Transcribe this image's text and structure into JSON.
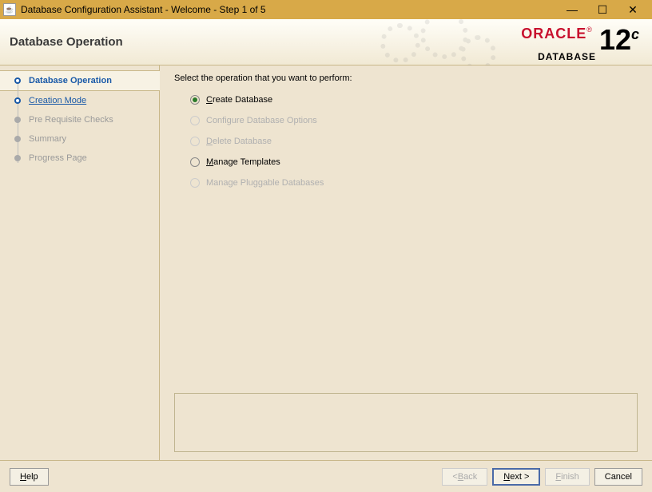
{
  "window": {
    "title": "Database Configuration Assistant - Welcome - Step 1 of 5"
  },
  "header": {
    "title": "Database Operation",
    "brand_top": "ORACLE",
    "brand_bottom": "DATABASE",
    "version": "12",
    "version_suffix": "c"
  },
  "sidebar": {
    "steps": [
      {
        "label": "Database Operation",
        "active": true
      },
      {
        "label": "Creation Mode",
        "link": true
      },
      {
        "label": "Pre Requisite Checks"
      },
      {
        "label": "Summary"
      },
      {
        "label": "Progress Page"
      }
    ]
  },
  "content": {
    "instruction": "Select the operation that you want to perform:",
    "options": [
      {
        "mn": "C",
        "rest": "reate Database",
        "selected": true,
        "enabled": true
      },
      {
        "mn": "",
        "rest": "Configure Database Options",
        "selected": false,
        "enabled": false
      },
      {
        "mn": "D",
        "rest": "elete Database",
        "selected": false,
        "enabled": false
      },
      {
        "mn": "M",
        "rest": "anage Templates",
        "selected": false,
        "enabled": true
      },
      {
        "mn": "",
        "rest": "Manage Pluggable Databases",
        "selected": false,
        "enabled": false
      }
    ]
  },
  "footer": {
    "help_mn": "H",
    "help_rest": "elp",
    "back_pre": "< ",
    "back_mn": "B",
    "back_rest": "ack",
    "next_mn": "N",
    "next_rest": "ext >",
    "finish_mn": "F",
    "finish_rest": "inish",
    "cancel": "Cancel"
  }
}
